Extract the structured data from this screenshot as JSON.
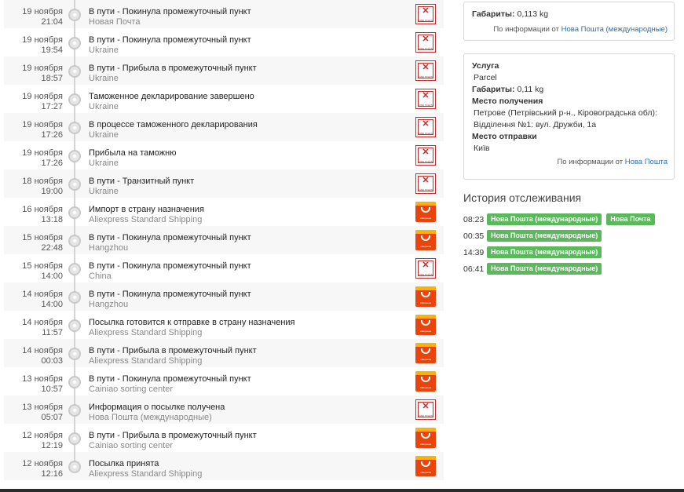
{
  "timeline": [
    {
      "date": "19 ноября",
      "time": "21:04",
      "status": "В пути - Покинула промежуточный пункт",
      "place": "Новая Почта",
      "carrier": "nova-poshta"
    },
    {
      "date": "19 ноября",
      "time": "19:54",
      "status": "В пути - Покинула промежуточный пункт",
      "place": "Ukraine",
      "carrier": "nova-poshta"
    },
    {
      "date": "19 ноября",
      "time": "18:57",
      "status": "В пути - Прибыла в промежуточный пункт",
      "place": "Ukraine",
      "carrier": "nova-poshta"
    },
    {
      "date": "19 ноября",
      "time": "17:27",
      "status": "Таможенное декларирование завершено",
      "place": "Ukraine",
      "carrier": "nova-poshta"
    },
    {
      "date": "19 ноября",
      "time": "17:26",
      "status": "В процессе таможенного декларирования",
      "place": "Ukraine",
      "carrier": "nova-poshta"
    },
    {
      "date": "19 ноября",
      "time": "17:26",
      "status": "Прибыла на таможню",
      "place": "Ukraine",
      "carrier": "nova-poshta"
    },
    {
      "date": "18 ноября",
      "time": "19:00",
      "status": "В пути - Транзитный пункт",
      "place": "Ukraine",
      "carrier": "nova-poshta"
    },
    {
      "date": "16 ноября",
      "time": "13:18",
      "status": "Импорт в страну назначения",
      "place": "Aliexpress Standard Shipping",
      "carrier": "aliexpress"
    },
    {
      "date": "15 ноября",
      "time": "22:48",
      "status": "В пути - Покинула промежуточный пункт",
      "place": "Hangzhou",
      "carrier": "aliexpress"
    },
    {
      "date": "15 ноября",
      "time": "14:00",
      "status": "В пути - Покинула промежуточный пункт",
      "place": "China",
      "carrier": "nova-poshta"
    },
    {
      "date": "14 ноября",
      "time": "14:00",
      "status": "В пути - Покинула промежуточный пункт",
      "place": "Hangzhou",
      "carrier": "aliexpress"
    },
    {
      "date": "14 ноября",
      "time": "11:57",
      "status": "Посылка готовится к отправке в страну назначения",
      "place": "Aliexpress Standard Shipping",
      "carrier": "aliexpress"
    },
    {
      "date": "14 ноября",
      "time": "00:03",
      "status": "В пути - Прибыла в промежуточный пункт",
      "place": "Aliexpress Standard Shipping",
      "carrier": "aliexpress"
    },
    {
      "date": "13 ноября",
      "time": "10:57",
      "status": "В пути - Покинула промежуточный пункт",
      "place": "Cainiao sorting center",
      "carrier": "aliexpress"
    },
    {
      "date": "13 ноября",
      "time": "05:07",
      "status": "Информация о посылке получена",
      "place": "Нова Пошта (международные)",
      "carrier": "nova-poshta"
    },
    {
      "date": "12 ноября",
      "time": "12:19",
      "status": "В пути - Прибыла в промежуточный пункт",
      "place": "Cainiao sorting center",
      "carrier": "aliexpress"
    },
    {
      "date": "12 ноября",
      "time": "12:16",
      "status": "Посылка принята",
      "place": "Aliexpress Standard Shipping",
      "carrier": "aliexpress"
    }
  ],
  "logos": {
    "nova_poshta_glyph": "✕",
    "nova_poshta_text": "НОВА ПОШТА",
    "aliexpress_text": "AliExpress"
  },
  "card1": {
    "dims_label": "Габариты:",
    "dims_value": "0,113 kg",
    "source_prefix": "По информации от",
    "source_link": "Нова Пошта (международные)"
  },
  "card2": {
    "service_label": "Услуга",
    "service_value": "Parcel",
    "dims_label": "Габариты:",
    "dims_value": "0,11 kg",
    "dest_label": "Место получения",
    "dest_line1": "Петрове (Петрівський р-н., Кіровоградська обл):",
    "dest_line2": "Відділення №1: вул. Дружби, 1а",
    "origin_label": "Место отправки",
    "origin_value": "Київ",
    "source_prefix": "По информации от",
    "source_link": "Нова Пошта"
  },
  "history": {
    "title": "История отслеживания",
    "rows": [
      {
        "time": "08:23",
        "tags": [
          "Нова Пошта (международные)",
          "Нова Почта"
        ]
      },
      {
        "time": "00:35",
        "tags": [
          "Нова Пошта (международные)"
        ]
      },
      {
        "time": "14:39",
        "tags": [
          "Нова Пошта (международные)"
        ]
      },
      {
        "time": "06:41",
        "tags": [
          "Нова Пошта (международные)"
        ]
      }
    ]
  },
  "colors": {
    "tag_green": "#5cb85c",
    "nova_red": "#c62828",
    "aliexpress_orange": "#e8440b",
    "link_blue": "#2a6fb0"
  }
}
